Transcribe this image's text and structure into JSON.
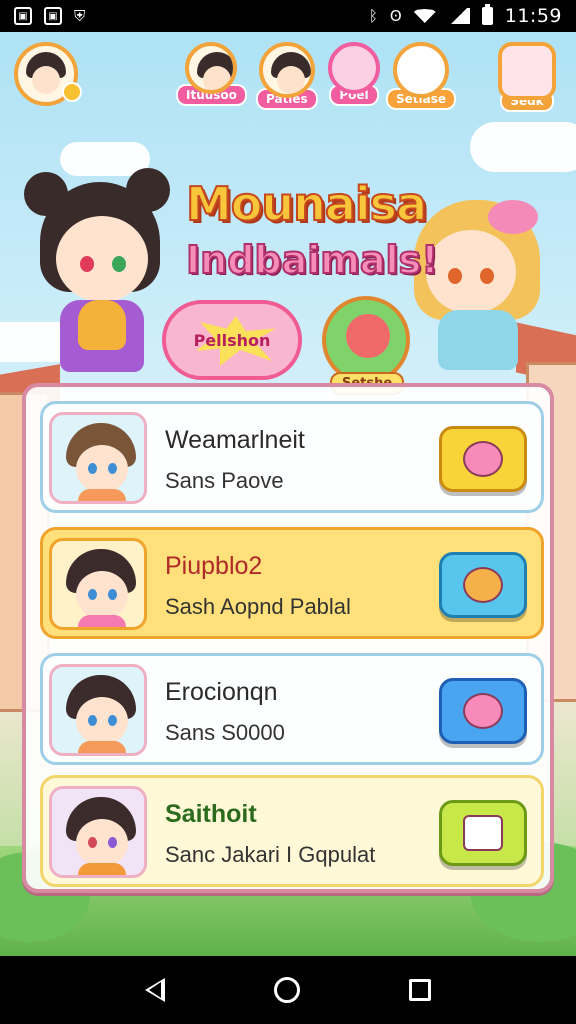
{
  "status_bar": {
    "time": "11:59",
    "left_icons": [
      "image-icon",
      "image-icon",
      "shield-icon"
    ],
    "right_icons": [
      "bluetooth-icon",
      "nfc-icon",
      "wifi-icon",
      "signal-icon",
      "battery-icon"
    ]
  },
  "header": {
    "avatars": [
      {
        "label": "",
        "name": "profile"
      },
      {
        "label": "Ituusoo",
        "name": "friend-1"
      },
      {
        "label": "Patles",
        "name": "friend-2"
      },
      {
        "label": "Poel",
        "name": "friend-3"
      },
      {
        "label": "Setlase",
        "name": "friend-4"
      },
      {
        "label": "Sedk",
        "name": "settings"
      }
    ]
  },
  "title": {
    "line1": "Mounaisa",
    "line2": "Indbaimals!"
  },
  "promo": {
    "bubble_label": "Pellshon",
    "badge_label": "Setshe"
  },
  "cards": [
    {
      "title": "Weamarlneit",
      "subtitle": "Sans Paove",
      "button_color": "#f8d438"
    },
    {
      "title": "Piupblo2",
      "subtitle": "Sash Aopnd Pablal",
      "button_color": "#58c6ec"
    },
    {
      "title": "Erocionqn",
      "subtitle": "Sans S0000",
      "button_color": "#4aa5f0"
    },
    {
      "title": "Saithoit",
      "subtitle": "Sanc Jakari I Gqpulat",
      "button_color": "#c8e84a"
    }
  ],
  "colors": {
    "accent_pink": "#f25da0",
    "title_yellow": "#f9c53a",
    "highlight_card": "#ffe07a"
  }
}
